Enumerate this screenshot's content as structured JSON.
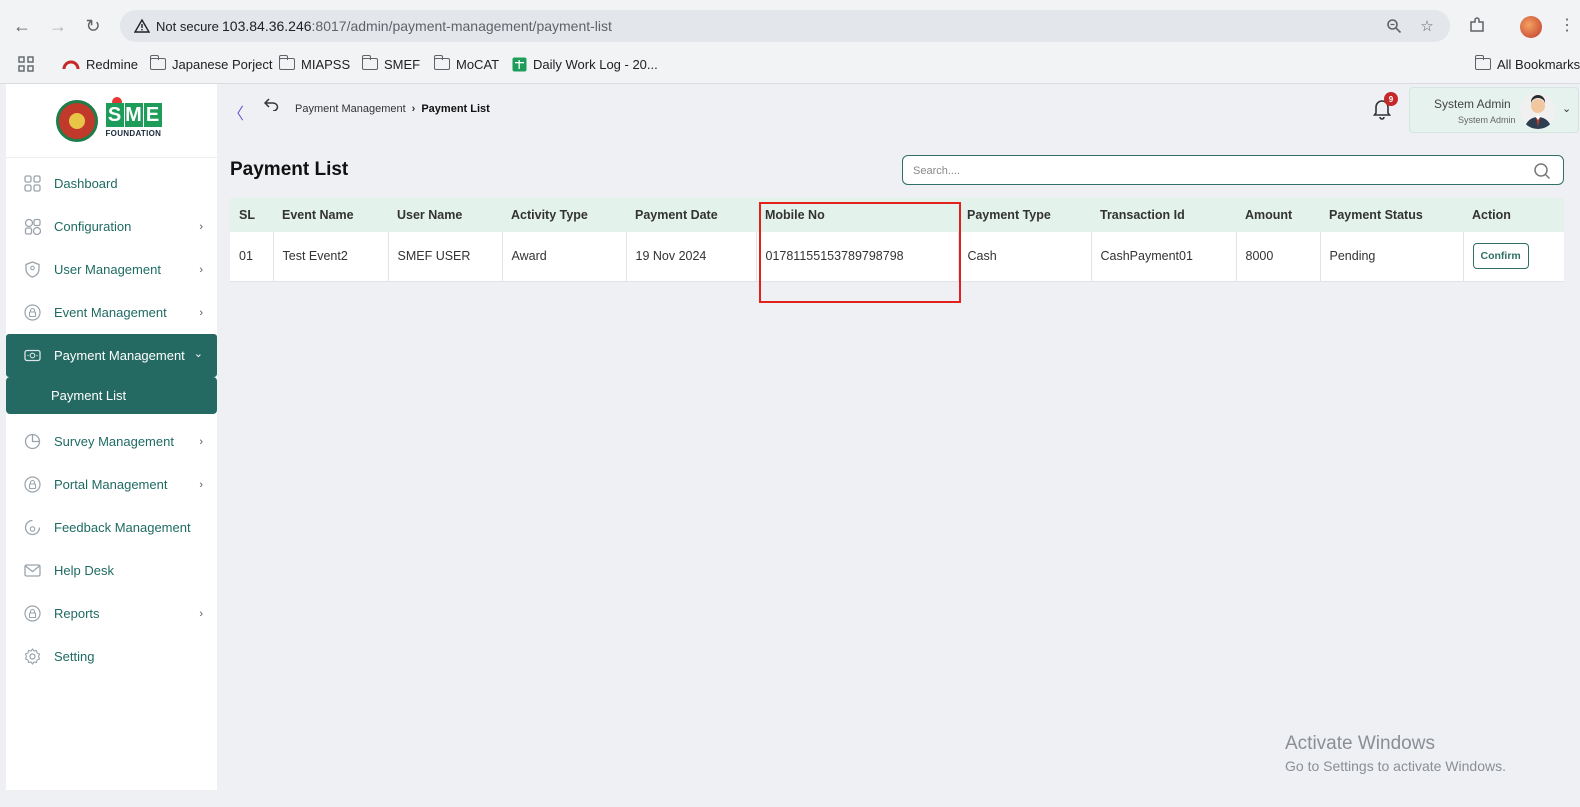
{
  "browser": {
    "not_secure_label": "Not secure",
    "url_host": "103.84.36.246",
    "url_path": ":8017/admin/payment-management/payment-list",
    "bookmarks": [
      "Redmine",
      "Japanese Porject",
      "MIAPSS",
      "SMEF",
      "MoCAT",
      "Daily Work Log - 20...",
      "All Bookmarks"
    ]
  },
  "logo": {
    "sme": "SME",
    "foundation": "FOUNDATION"
  },
  "sidebar": {
    "items": [
      {
        "label": "Dashboard",
        "icon": "grid-icon",
        "has_children": false
      },
      {
        "label": "Configuration",
        "icon": "config-icon",
        "has_children": true
      },
      {
        "label": "User Management",
        "icon": "shield-icon",
        "has_children": true
      },
      {
        "label": "Event Management",
        "icon": "lock-icon",
        "has_children": true
      },
      {
        "label": "Payment Management",
        "icon": "money-icon",
        "has_children": true,
        "active": true
      },
      {
        "label": "Survey Management",
        "icon": "pie-icon",
        "has_children": true
      },
      {
        "label": "Portal Management",
        "icon": "lock-icon",
        "has_children": true
      },
      {
        "label": "Feedback Management",
        "icon": "feedback-icon",
        "has_children": false
      },
      {
        "label": "Help Desk",
        "icon": "mail-icon",
        "has_children": false
      },
      {
        "label": "Reports",
        "icon": "lock-icon",
        "has_children": true
      },
      {
        "label": "Setting",
        "icon": "gear-icon",
        "has_children": false
      }
    ],
    "payment_submenu": {
      "label": "Payment List"
    }
  },
  "header": {
    "breadcrumb_parent": "Payment Management",
    "breadcrumb_current": "Payment List",
    "notification_count": "9",
    "user_name": "System Admin",
    "user_role": "System Admin"
  },
  "main": {
    "title": "Payment List",
    "search_placeholder": "Search....",
    "table": {
      "headers": [
        "SL",
        "Event Name",
        "User Name",
        "Activity Type",
        "Payment Date",
        "Mobile No",
        "Payment Type",
        "Transaction Id",
        "Amount",
        "Payment Status",
        "Action"
      ],
      "rows": [
        [
          "01",
          "Test Event2",
          "SMEF USER",
          "Award",
          "19 Nov 2024",
          "01781155153789798798",
          "Cash",
          "CashPayment01",
          "8000",
          "Pending"
        ]
      ],
      "action_label": "Confirm"
    }
  },
  "watermark": {
    "title": "Activate Windows",
    "subtitle": "Go to Settings to activate Windows."
  },
  "colors": {
    "primary": "#256963",
    "header_bg": "#e4f2ec",
    "highlight": "#e3211b"
  }
}
